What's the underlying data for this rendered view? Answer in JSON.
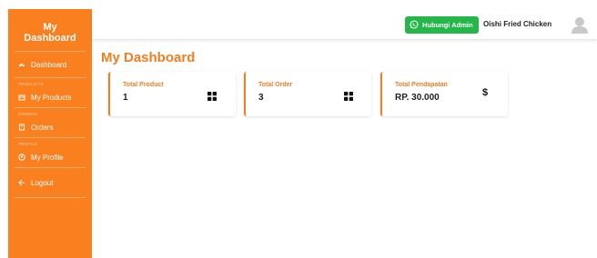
{
  "sidebar": {
    "brand_line1": "My",
    "brand_line2": "Dashboard",
    "items": [
      {
        "label": "Dashboard",
        "icon": "dashboard-icon"
      },
      {
        "section": "PRODUCTS",
        "label": "My Products",
        "icon": "box-icon"
      },
      {
        "section": "ORDERS",
        "label": "Orders",
        "icon": "receipt-icon"
      },
      {
        "section": "PROFILE",
        "label": "My Profile",
        "icon": "user-circle-icon"
      },
      {
        "label": "Logout",
        "icon": "logout-icon"
      }
    ]
  },
  "topbar": {
    "whatsapp_label": "Hubungi Admin",
    "shop_name": "Oishi Fried Chicken"
  },
  "main": {
    "title": "My Dashboard",
    "cards": [
      {
        "label": "Total Product",
        "value": "1",
        "icon": "grid-icon"
      },
      {
        "label": "Total Order",
        "value": "3",
        "icon": "grid-icon"
      },
      {
        "label": "Total Pendapatan",
        "value": "RP. 30.000",
        "icon": "dollar-icon",
        "icon_text": "$"
      }
    ]
  },
  "colors": {
    "accent": "#fa7f1f",
    "title": "#f07e22",
    "whatsapp": "#25b64a"
  }
}
